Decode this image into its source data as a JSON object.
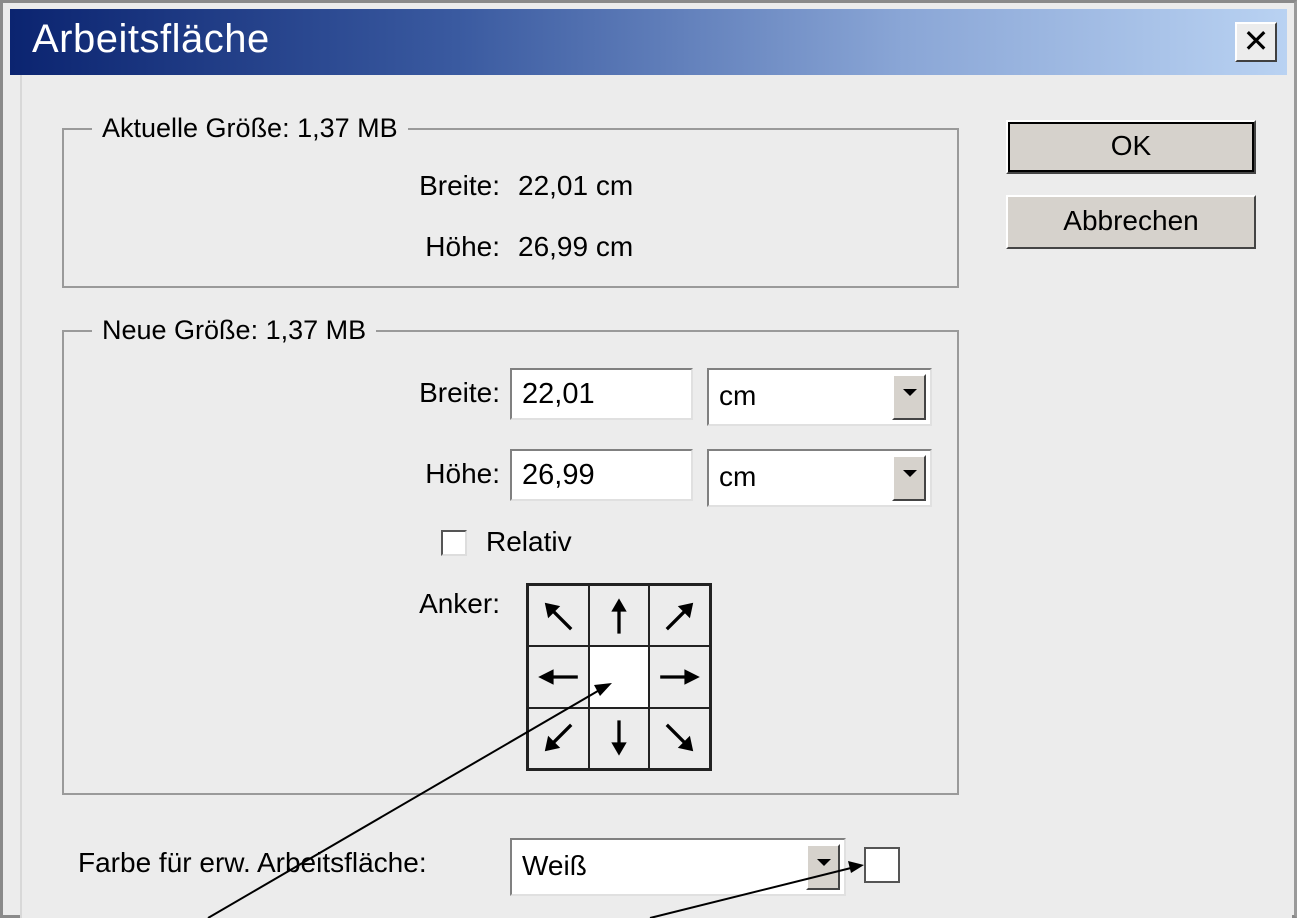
{
  "dialog": {
    "title": "Arbeitsfläche"
  },
  "current_size": {
    "legend": "Aktuelle Größe: 1,37 MB",
    "width_label": "Breite:",
    "width_value": "22,01 cm",
    "height_label": "Höhe:",
    "height_value": "26,99 cm"
  },
  "new_size": {
    "legend": "Neue Größe: 1,37 MB",
    "width_label": "Breite:",
    "width_value": "22,01",
    "width_unit": "cm",
    "height_label": "Höhe:",
    "height_value": "26,99",
    "height_unit": "cm",
    "relative_label": "Relativ",
    "relative_checked": false,
    "anchor_label": "Anker:"
  },
  "buttons": {
    "ok": "OK",
    "cancel": "Abbrechen"
  },
  "canvas_extension_color": {
    "label": "Farbe für erw. Arbeitsfläche:",
    "value": "Weiß",
    "swatch_color": "#ffffff"
  },
  "anchor_icons": [
    "arrow-up-left-icon",
    "arrow-up-icon",
    "arrow-up-right-icon",
    "arrow-left-icon",
    "anchor-center",
    "arrow-right-icon",
    "arrow-down-left-icon",
    "arrow-down-icon",
    "arrow-down-right-icon"
  ]
}
